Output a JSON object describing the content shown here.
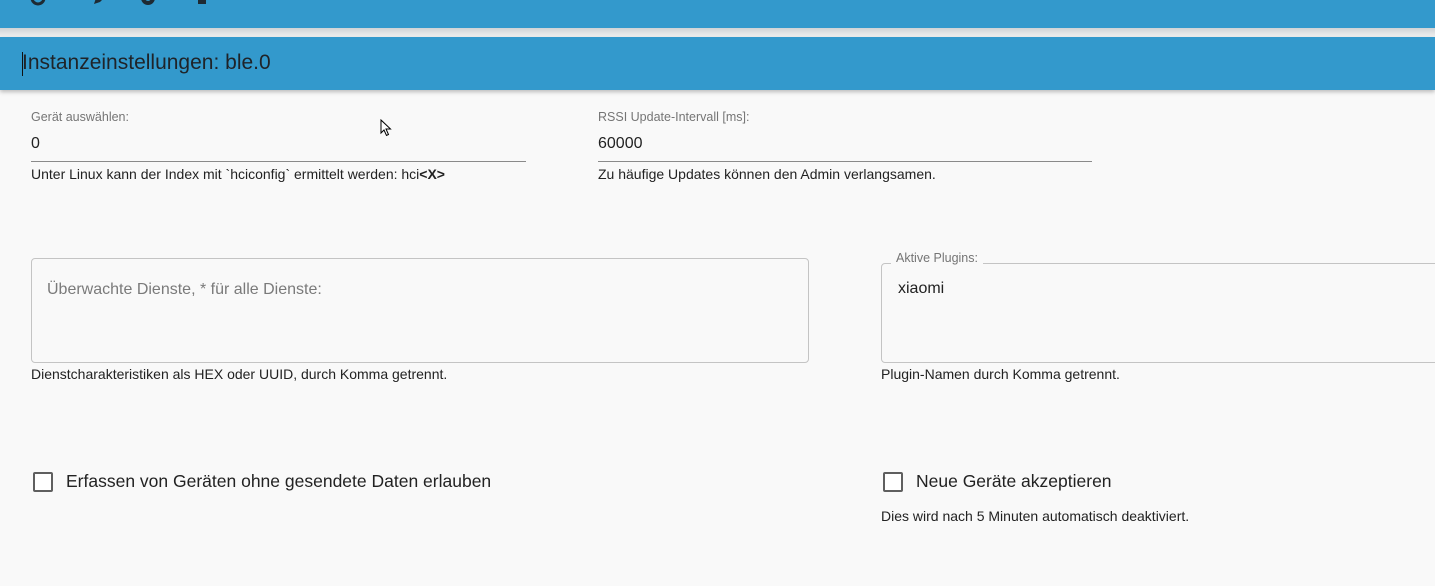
{
  "toolbar": {
    "icons": [
      "refresh-icon",
      "edit-icon",
      "settings-icon",
      "more-icon"
    ]
  },
  "dialog": {
    "title": "Instanzeinstellungen: ble.0"
  },
  "fields": {
    "device": {
      "label": "Gerät auswählen:",
      "value": "0",
      "helper_text": "Unter Linux kann der Index mit `hciconfig` ermittelt werden: hci",
      "helper_bold": "<X>"
    },
    "rssi": {
      "label": "RSSI Update-Intervall [ms]:",
      "value": "60000",
      "helper": "Zu häufige Updates können den Admin verlangsamen."
    },
    "services": {
      "placeholder": "Überwachte Dienste, * für alle Dienste:",
      "value": "",
      "helper": "Dienstcharakteristiken als HEX oder UUID, durch Komma getrennt."
    },
    "plugins": {
      "label": "Aktive Plugins:",
      "value": "xiaomi",
      "helper": "Plugin-Namen durch Komma getrennt."
    }
  },
  "checkboxes": {
    "allow_no_data": {
      "label": "Erfassen von Geräten ohne gesendete Daten erlauben",
      "checked": false
    },
    "accept_new": {
      "label": "Neue Geräte akzeptieren",
      "checked": false,
      "helper": "Dies wird nach 5 Minuten automatisch deaktiviert."
    }
  }
}
